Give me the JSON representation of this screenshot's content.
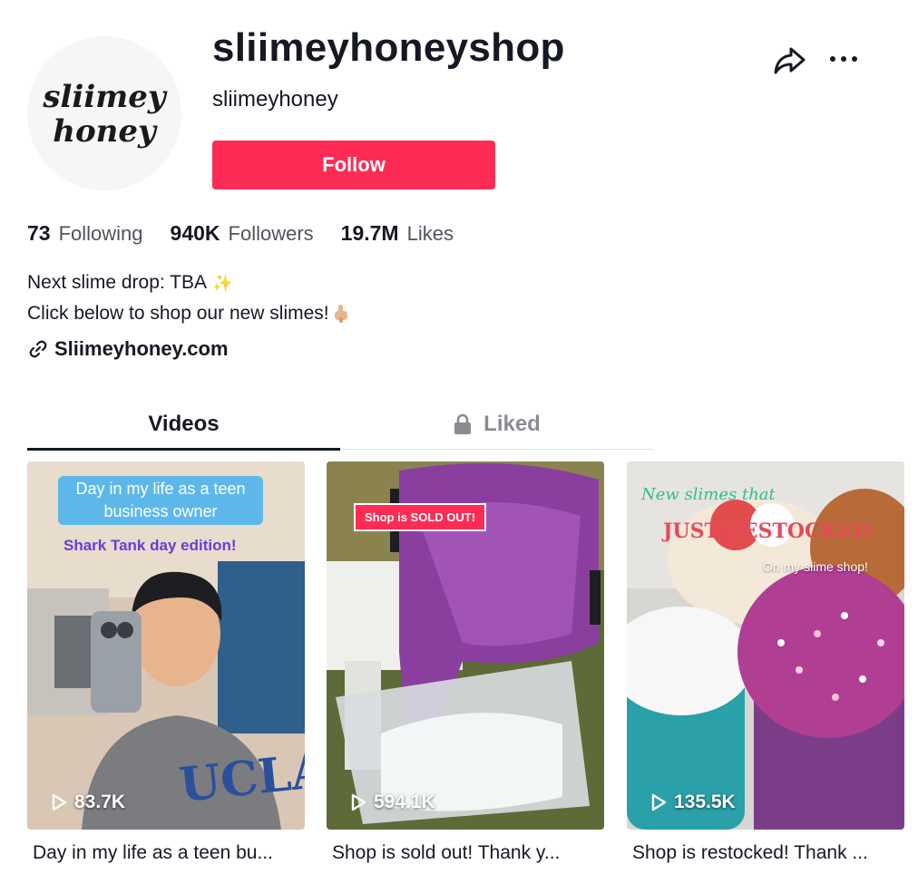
{
  "profile": {
    "username": "sliimeyhoneyshop",
    "nickname": "sliimeyhoney",
    "avatar_text": "sliimey honey",
    "follow_label": "Follow"
  },
  "actions": {
    "share_icon": "share-arrow-icon",
    "more_icon": "more-dots-icon"
  },
  "stats": [
    {
      "value": "73",
      "label": "Following"
    },
    {
      "value": "940K",
      "label": "Followers"
    },
    {
      "value": "19.7M",
      "label": "Likes"
    }
  ],
  "bio": {
    "line1": "Next slime drop: TBA",
    "line1_emoji": "✨",
    "line2": "Click below to shop our new slimes!",
    "line2_emoji": "point-down-icon"
  },
  "link": {
    "text": "Sliimeyhoney.com",
    "icon": "link-icon"
  },
  "tabs": [
    {
      "label": "Videos",
      "active": true
    },
    {
      "label": "Liked",
      "active": false,
      "icon": "lock-icon"
    }
  ],
  "videos": [
    {
      "views": "83.7K",
      "caption": "Day in my life as a teen bu...",
      "overlay_bubble": "Day in my life as a teen business owner",
      "overlay_sub": "Shark Tank day edition!"
    },
    {
      "views": "594.1K",
      "caption": "Shop is sold out! Thank y...",
      "overlay_tag": "Shop is SOLD OUT!"
    },
    {
      "views": "135.5K",
      "caption": "Shop is restocked! Thank ...",
      "overlay_line1": "New slimes that",
      "overlay_line2": "JUST RESTOCKED",
      "overlay_line3": "On my slime shop!"
    }
  ],
  "colors": {
    "accent": "#fe2c55",
    "text": "#161823"
  }
}
